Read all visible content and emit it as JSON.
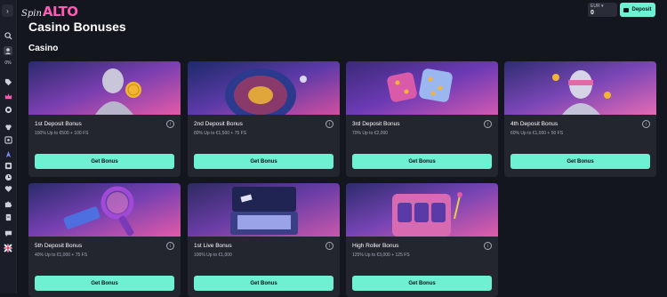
{
  "brand": {
    "logo_prefix": "Spin",
    "logo_main": "ALTO"
  },
  "header": {
    "wallet": {
      "currency": "EUR ▾",
      "balance": "0"
    },
    "deposit_label": "Deposit"
  },
  "sidebar": {
    "percent": "0%"
  },
  "page": {
    "title": "Casino Bonuses",
    "section": "Casino"
  },
  "cards": [
    {
      "title": "1st Deposit Bonus",
      "desc": "100% Up to €500 + 100 FS",
      "button": "Get Bonus"
    },
    {
      "title": "2nd Deposit Bonus",
      "desc": "80% Up to €1,500 + 75 FS",
      "button": "Get Bonus"
    },
    {
      "title": "3rd Deposit Bonus",
      "desc": "70% Up to €2,000",
      "button": "Get Bonus"
    },
    {
      "title": "4th Deposit Bonus",
      "desc": "60% Up to €1,000 + 50 FS",
      "button": "Get Bonus"
    },
    {
      "title": "5th Deposit Bonus",
      "desc": "40% Up to €1,000 + 75 FS",
      "button": "Get Bonus"
    },
    {
      "title": "1st Live Bonus",
      "desc": "100% Up to €1,000",
      "button": "Get Bonus"
    },
    {
      "title": "High Roller Bonus",
      "desc": "125% Up to €3,000 + 125 FS",
      "button": "Get Bonus"
    }
  ],
  "colors": {
    "accent": "#6ef0d2",
    "brand": "#ff5bb3",
    "background": "#14161f",
    "card": "#23252f"
  }
}
